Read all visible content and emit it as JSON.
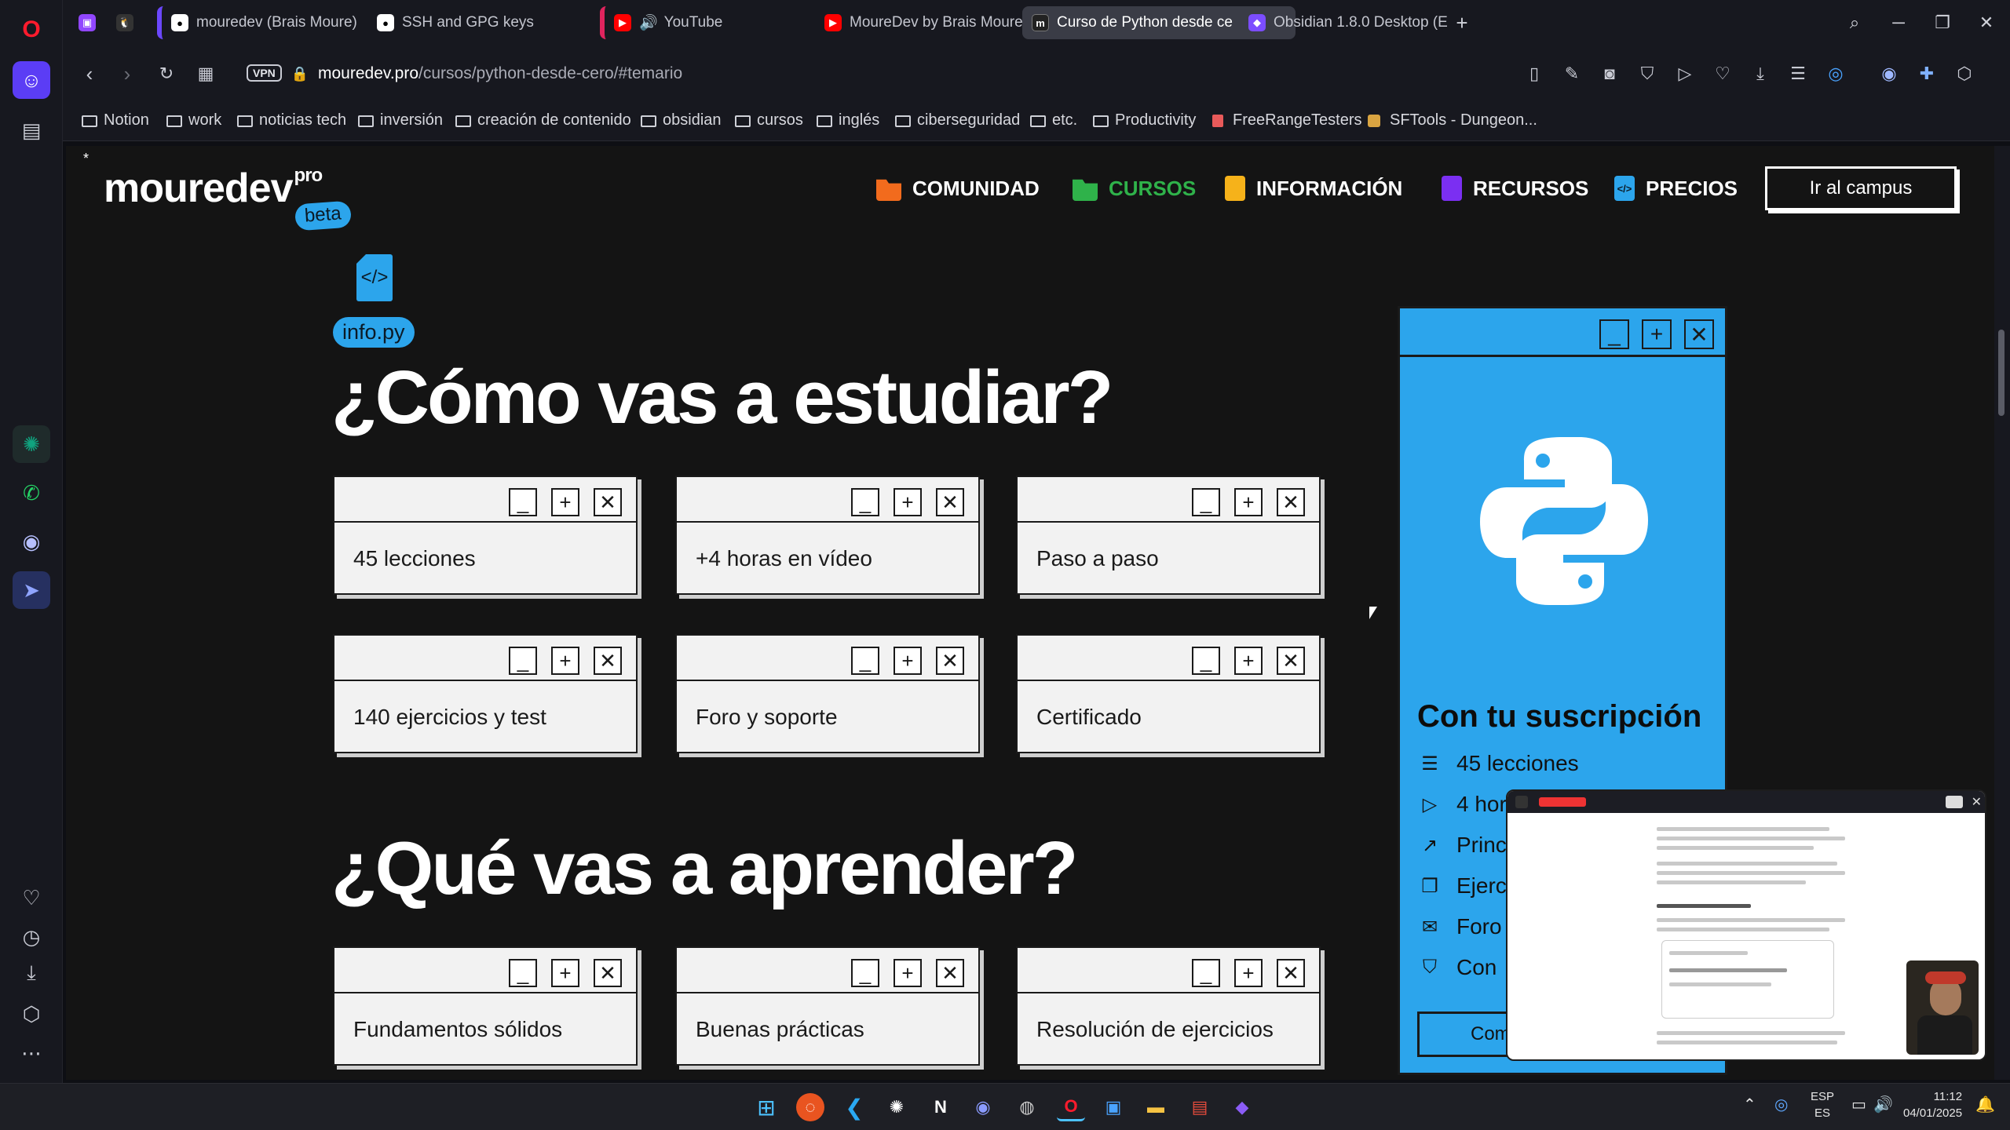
{
  "browser": {
    "tabs": [
      {
        "title": "",
        "icon": "twitch-icon",
        "color": "#9146ff"
      },
      {
        "title": "",
        "icon": "linux-icon",
        "color": "#444"
      },
      {
        "title": "mouredev (Brais Moure)",
        "icon": "github-icon",
        "color": "#fff"
      },
      {
        "title": "SSH and GPG keys",
        "icon": "github-icon",
        "color": "#fff"
      },
      {
        "title": "YouTube",
        "icon": "youtube-icon",
        "color": "#ff0000"
      },
      {
        "title": "MoureDev by Brais Moure",
        "icon": "youtube-icon",
        "color": "#ff0000"
      },
      {
        "title": "Curso de Python desde ce",
        "icon": "mouredev-icon",
        "color": "#222"
      },
      {
        "title": "Obsidian 1.8.0 Desktop (E",
        "icon": "obsidian-icon",
        "color": "#8b5cf6"
      }
    ],
    "url_domain": "mouredev.pro",
    "url_path": "/cursos/python-desde-cero/#temario",
    "vpn_label": "VPN",
    "bookmarks": [
      "Notion",
      "work",
      "noticias tech",
      "inversión",
      "creación de contenido",
      "obsidian",
      "cursos",
      "inglés",
      "ciberseguridad",
      "etc.",
      "Productivity",
      "FreeRangeTesters",
      "SFTools - Dungeon..."
    ]
  },
  "site": {
    "logo_text": "mouredev",
    "logo_sup": "pro",
    "beta_label": "beta",
    "nav": [
      {
        "label": "COMUNIDAD",
        "color": "#f26b1d"
      },
      {
        "label": "CURSOS",
        "color": "#2fb24a",
        "active": true
      },
      {
        "label": "INFORMACIÓN",
        "color": "#f6b21a"
      },
      {
        "label": "RECURSOS",
        "color": "#7b2ff2"
      },
      {
        "label": "PRECIOS",
        "color": "#2ca5ec"
      }
    ],
    "campus_button": "Ir al campus",
    "file_tag": "info.py",
    "heading_study": "¿Cómo vas a estudiar?",
    "heading_learn": "¿Qué vas a aprender?",
    "study_cards": [
      "45 lecciones",
      "+4 horas en vídeo",
      "Paso a paso",
      "140 ejercicios y test",
      "Foro y soporte",
      "Certificado"
    ],
    "learn_cards": [
      "Fundamentos sólidos",
      "Buenas prácticas",
      "Resolución de ejercicios"
    ],
    "panel_title": "Con tu suscripción",
    "panel_features": [
      "45 lecciones",
      "4 hor",
      "Princ",
      "Ejerci",
      "Foro",
      "Con"
    ],
    "panel_cta": "Come",
    "accent": "#2ca5ec"
  },
  "taskbar": {
    "lang_top": "ESP",
    "lang_bottom": "ES",
    "time": "11:12",
    "date": "04/01/2025"
  }
}
